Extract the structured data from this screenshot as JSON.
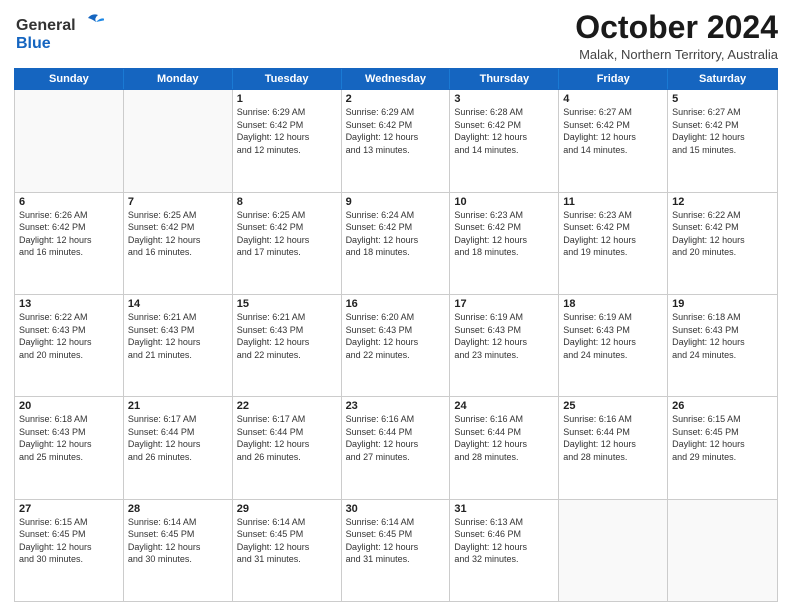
{
  "logo": {
    "line1": "General",
    "line2": "Blue"
  },
  "title": "October 2024",
  "location": "Malak, Northern Territory, Australia",
  "weekdays": [
    "Sunday",
    "Monday",
    "Tuesday",
    "Wednesday",
    "Thursday",
    "Friday",
    "Saturday"
  ],
  "rows": [
    [
      {
        "day": "",
        "detail": ""
      },
      {
        "day": "",
        "detail": ""
      },
      {
        "day": "1",
        "detail": "Sunrise: 6:29 AM\nSunset: 6:42 PM\nDaylight: 12 hours\nand 12 minutes."
      },
      {
        "day": "2",
        "detail": "Sunrise: 6:29 AM\nSunset: 6:42 PM\nDaylight: 12 hours\nand 13 minutes."
      },
      {
        "day": "3",
        "detail": "Sunrise: 6:28 AM\nSunset: 6:42 PM\nDaylight: 12 hours\nand 14 minutes."
      },
      {
        "day": "4",
        "detail": "Sunrise: 6:27 AM\nSunset: 6:42 PM\nDaylight: 12 hours\nand 14 minutes."
      },
      {
        "day": "5",
        "detail": "Sunrise: 6:27 AM\nSunset: 6:42 PM\nDaylight: 12 hours\nand 15 minutes."
      }
    ],
    [
      {
        "day": "6",
        "detail": "Sunrise: 6:26 AM\nSunset: 6:42 PM\nDaylight: 12 hours\nand 16 minutes."
      },
      {
        "day": "7",
        "detail": "Sunrise: 6:25 AM\nSunset: 6:42 PM\nDaylight: 12 hours\nand 16 minutes."
      },
      {
        "day": "8",
        "detail": "Sunrise: 6:25 AM\nSunset: 6:42 PM\nDaylight: 12 hours\nand 17 minutes."
      },
      {
        "day": "9",
        "detail": "Sunrise: 6:24 AM\nSunset: 6:42 PM\nDaylight: 12 hours\nand 18 minutes."
      },
      {
        "day": "10",
        "detail": "Sunrise: 6:23 AM\nSunset: 6:42 PM\nDaylight: 12 hours\nand 18 minutes."
      },
      {
        "day": "11",
        "detail": "Sunrise: 6:23 AM\nSunset: 6:42 PM\nDaylight: 12 hours\nand 19 minutes."
      },
      {
        "day": "12",
        "detail": "Sunrise: 6:22 AM\nSunset: 6:42 PM\nDaylight: 12 hours\nand 20 minutes."
      }
    ],
    [
      {
        "day": "13",
        "detail": "Sunrise: 6:22 AM\nSunset: 6:43 PM\nDaylight: 12 hours\nand 20 minutes."
      },
      {
        "day": "14",
        "detail": "Sunrise: 6:21 AM\nSunset: 6:43 PM\nDaylight: 12 hours\nand 21 minutes."
      },
      {
        "day": "15",
        "detail": "Sunrise: 6:21 AM\nSunset: 6:43 PM\nDaylight: 12 hours\nand 22 minutes."
      },
      {
        "day": "16",
        "detail": "Sunrise: 6:20 AM\nSunset: 6:43 PM\nDaylight: 12 hours\nand 22 minutes."
      },
      {
        "day": "17",
        "detail": "Sunrise: 6:19 AM\nSunset: 6:43 PM\nDaylight: 12 hours\nand 23 minutes."
      },
      {
        "day": "18",
        "detail": "Sunrise: 6:19 AM\nSunset: 6:43 PM\nDaylight: 12 hours\nand 24 minutes."
      },
      {
        "day": "19",
        "detail": "Sunrise: 6:18 AM\nSunset: 6:43 PM\nDaylight: 12 hours\nand 24 minutes."
      }
    ],
    [
      {
        "day": "20",
        "detail": "Sunrise: 6:18 AM\nSunset: 6:43 PM\nDaylight: 12 hours\nand 25 minutes."
      },
      {
        "day": "21",
        "detail": "Sunrise: 6:17 AM\nSunset: 6:44 PM\nDaylight: 12 hours\nand 26 minutes."
      },
      {
        "day": "22",
        "detail": "Sunrise: 6:17 AM\nSunset: 6:44 PM\nDaylight: 12 hours\nand 26 minutes."
      },
      {
        "day": "23",
        "detail": "Sunrise: 6:16 AM\nSunset: 6:44 PM\nDaylight: 12 hours\nand 27 minutes."
      },
      {
        "day": "24",
        "detail": "Sunrise: 6:16 AM\nSunset: 6:44 PM\nDaylight: 12 hours\nand 28 minutes."
      },
      {
        "day": "25",
        "detail": "Sunrise: 6:16 AM\nSunset: 6:44 PM\nDaylight: 12 hours\nand 28 minutes."
      },
      {
        "day": "26",
        "detail": "Sunrise: 6:15 AM\nSunset: 6:45 PM\nDaylight: 12 hours\nand 29 minutes."
      }
    ],
    [
      {
        "day": "27",
        "detail": "Sunrise: 6:15 AM\nSunset: 6:45 PM\nDaylight: 12 hours\nand 30 minutes."
      },
      {
        "day": "28",
        "detail": "Sunrise: 6:14 AM\nSunset: 6:45 PM\nDaylight: 12 hours\nand 30 minutes."
      },
      {
        "day": "29",
        "detail": "Sunrise: 6:14 AM\nSunset: 6:45 PM\nDaylight: 12 hours\nand 31 minutes."
      },
      {
        "day": "30",
        "detail": "Sunrise: 6:14 AM\nSunset: 6:45 PM\nDaylight: 12 hours\nand 31 minutes."
      },
      {
        "day": "31",
        "detail": "Sunrise: 6:13 AM\nSunset: 6:46 PM\nDaylight: 12 hours\nand 32 minutes."
      },
      {
        "day": "",
        "detail": ""
      },
      {
        "day": "",
        "detail": ""
      }
    ]
  ]
}
